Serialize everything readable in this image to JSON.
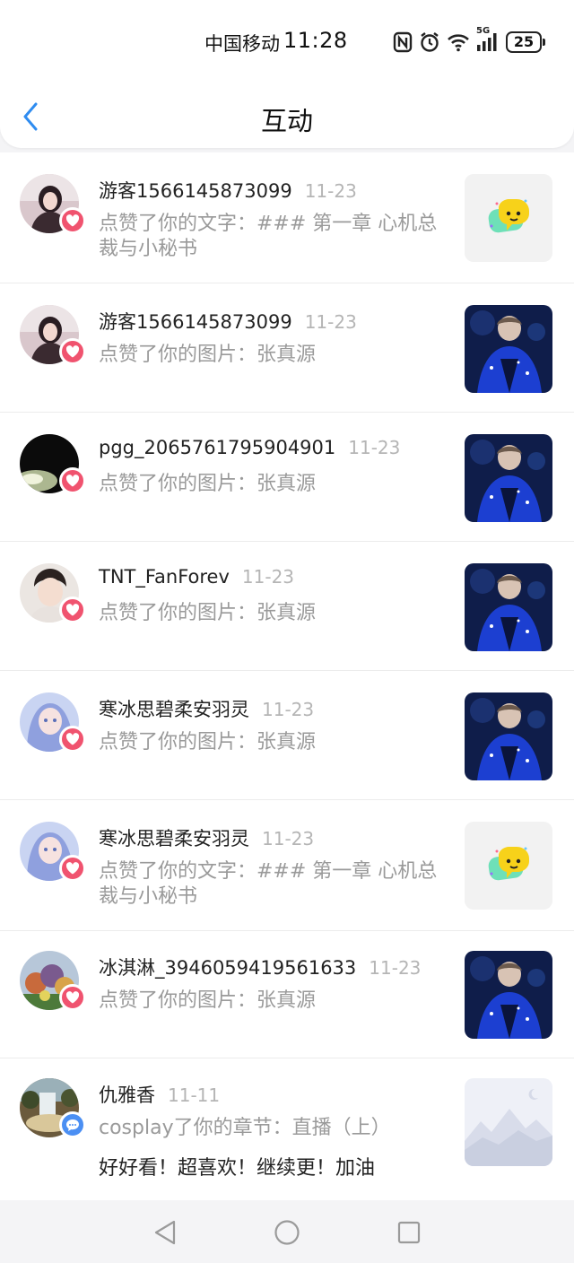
{
  "status_bar": {
    "carrier": "中国移动",
    "time": "11:28",
    "network": "5G",
    "battery": "25",
    "icons": [
      "nfc-icon",
      "alarm-icon",
      "wifi-icon",
      "signal-icon",
      "battery-icon"
    ]
  },
  "header": {
    "title": "互动",
    "back_icon": "chevron-left-icon",
    "accent": "#2f8cf0"
  },
  "colors": {
    "like_badge": "#f0536f",
    "comment_badge": "#4b8ff3"
  },
  "notifications": [
    {
      "user": "游客1566145873099",
      "date": "11-23",
      "type": "like",
      "text": "点赞了你的文字：### 第一章 心机总裁与小秘书",
      "thumbnail": "emoji-sticker"
    },
    {
      "user": "游客1566145873099",
      "date": "11-23",
      "type": "like",
      "text": "点赞了你的图片：张真源",
      "thumbnail": "photo"
    },
    {
      "user": "pgg_2065761795904901",
      "date": "11-23",
      "type": "like",
      "text": "点赞了你的图片：张真源",
      "thumbnail": "photo"
    },
    {
      "user": "TNT_FanForev",
      "date": "11-23",
      "type": "like",
      "text": "点赞了你的图片：张真源",
      "thumbnail": "photo"
    },
    {
      "user": "寒冰思碧柔安羽灵",
      "date": "11-23",
      "type": "like",
      "text": "点赞了你的图片：张真源",
      "thumbnail": "photo"
    },
    {
      "user": "寒冰思碧柔安羽灵",
      "date": "11-23",
      "type": "like",
      "text": "点赞了你的文字：### 第一章 心机总裁与小秘书",
      "thumbnail": "emoji-sticker"
    },
    {
      "user": "冰淇淋_3946059419561633",
      "date": "11-23",
      "type": "like",
      "text": "点赞了你的图片：张真源",
      "thumbnail": "photo"
    },
    {
      "user": "仇雅香",
      "date": "11-11",
      "type": "comment",
      "text": "cosplay了你的章节：直播（上）",
      "reply": "好好看！超喜欢！继续更！加油",
      "thumbnail": "image-placeholder"
    }
  ],
  "nav_bar": {
    "buttons": [
      "back-triangle-icon",
      "home-circle-icon",
      "recents-square-icon"
    ]
  }
}
